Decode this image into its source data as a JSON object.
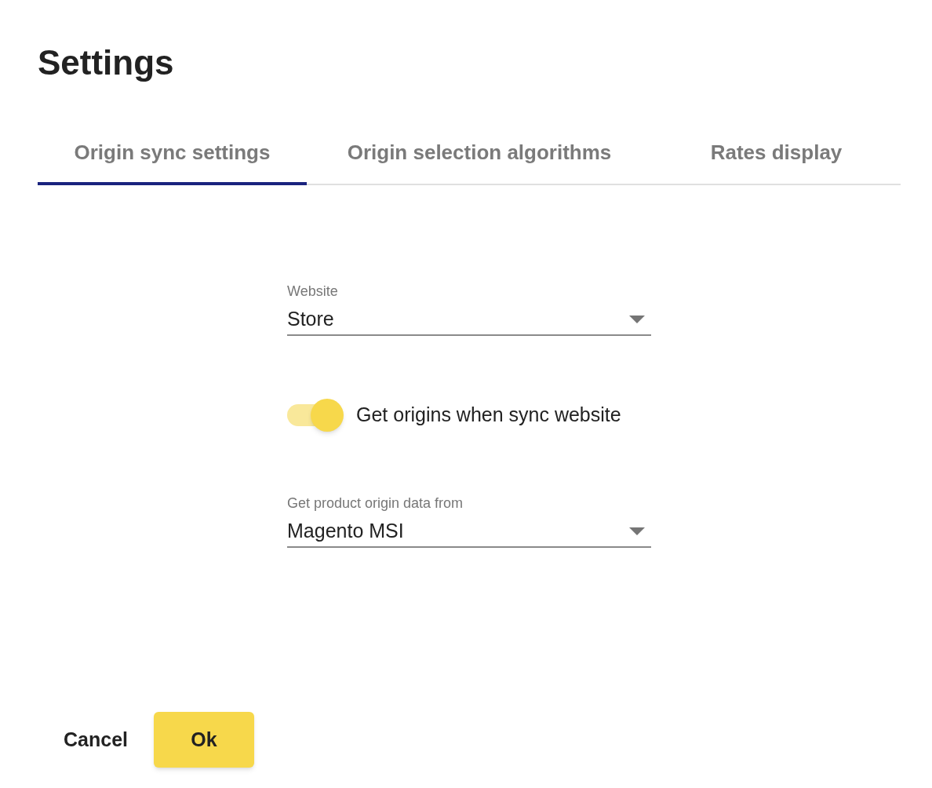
{
  "dialog": {
    "title": "Settings"
  },
  "tabs": [
    {
      "label": "Origin sync settings",
      "selected": true
    },
    {
      "label": "Origin selection algorithms",
      "selected": false
    },
    {
      "label": "Rates display",
      "selected": false
    }
  ],
  "form": [
    {
      "kind": "select",
      "label": "Website",
      "value": "Store"
    },
    {
      "kind": "toggle",
      "label": "Get origins when sync website",
      "on": true
    },
    {
      "kind": "select",
      "label": "Get product origin data from",
      "value": "Magento MSI"
    }
  ],
  "buttons": [
    {
      "label": "Cancel",
      "kind": "text"
    },
    {
      "label": "Ok",
      "kind": "primary"
    }
  ]
}
